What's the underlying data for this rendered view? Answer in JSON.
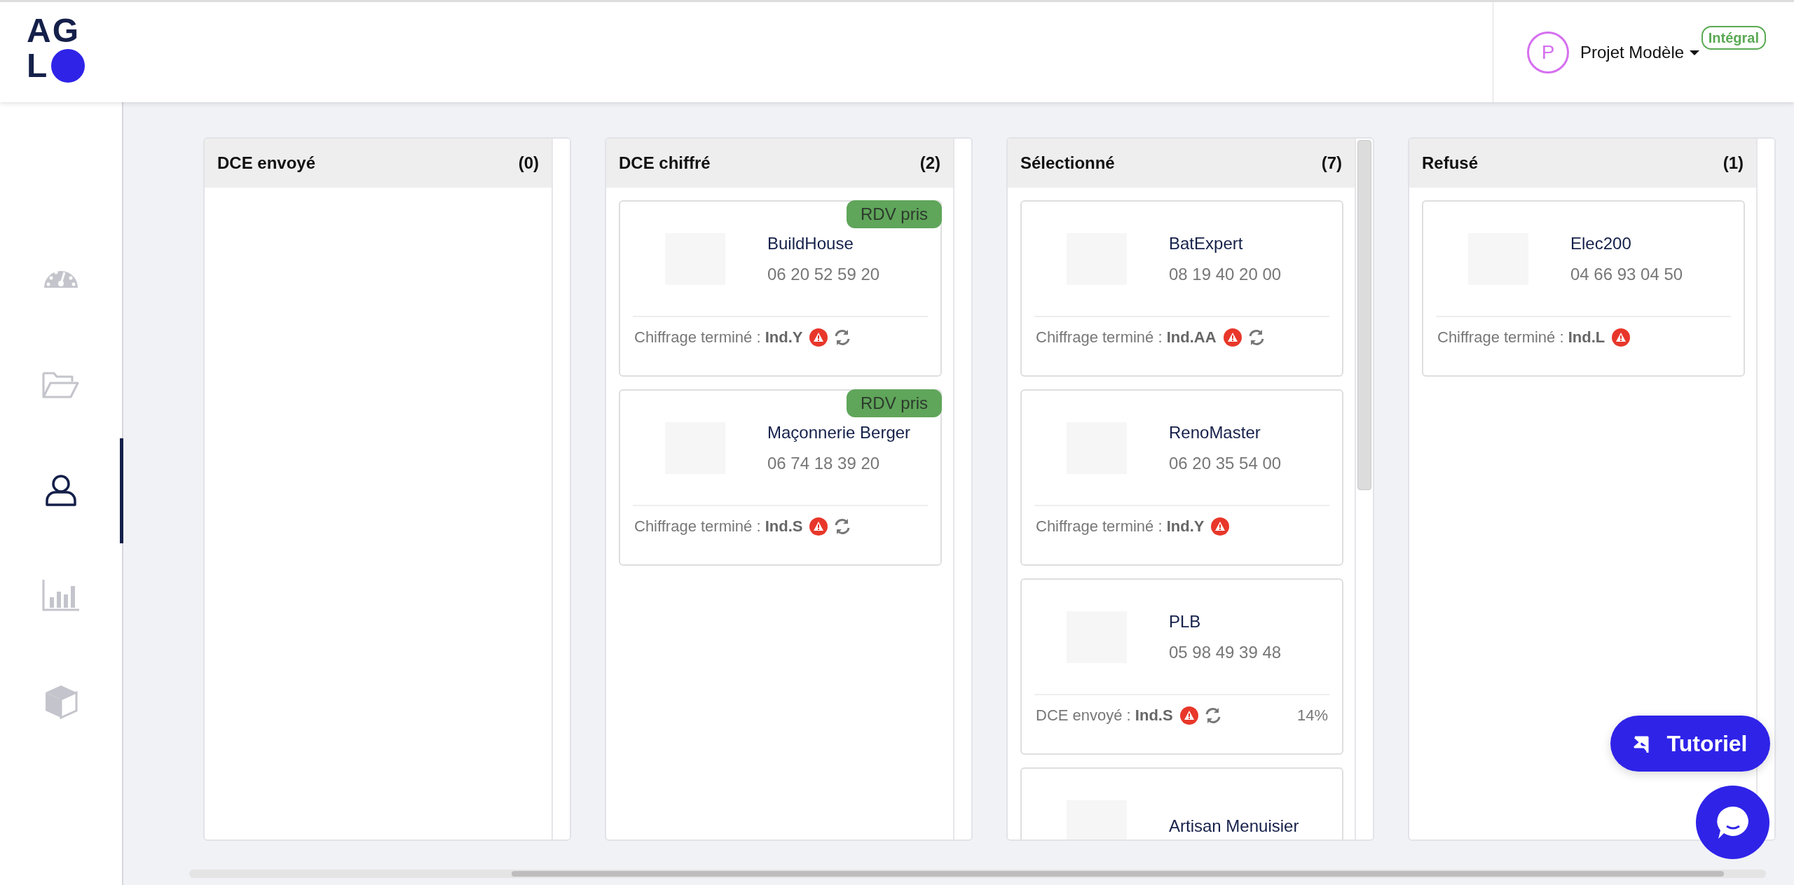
{
  "header": {
    "logo": {
      "line_1": "AG",
      "line_2": "L"
    },
    "user": {
      "avatar_letter": "P",
      "project": "Projet Modèle",
      "plan_badge": "Intégral"
    }
  },
  "sidebar": {
    "items": [
      {
        "kind": "gauge",
        "selected": false
      },
      {
        "kind": "folder",
        "selected": false
      },
      {
        "kind": "user",
        "selected": true
      },
      {
        "kind": "chart",
        "selected": false
      },
      {
        "kind": "cube",
        "selected": false
      }
    ]
  },
  "columns": [
    {
      "title": "DCE envoyé",
      "count": "(0)"
    },
    {
      "title": "DCE chiffré",
      "count": "(2)",
      "cards": [
        {
          "name": "BuildHouse",
          "phone": "06 20 52 59 20",
          "badge": "RDV pris",
          "status": "Chiffrage terminé : **Ind.Y**",
          "warning": true,
          "refresh": true
        },
        {
          "name": "Maçonnerie Berger",
          "phone": "06 74 18 39 20",
          "badge": "RDV pris",
          "status": "Chiffrage terminé : **Ind.S**",
          "warning": true,
          "refresh": true
        }
      ]
    },
    {
      "title": "Sélectionné",
      "count": "(7)",
      "scrollbar": true,
      "cards": [
        {
          "name": "BatExpert",
          "phone": "08 19 40 20 00",
          "status": "Chiffrage terminé : **Ind.AA**",
          "warning": true,
          "refresh": true
        },
        {
          "name": "RenoMaster",
          "phone": "06 20 35 54 00",
          "status": "Chiffrage terminé : **Ind.Y**",
          "warning": true,
          "refresh": false
        },
        {
          "name": "PLB",
          "phone": "05 98 49 39 48",
          "status": "DCE envoyé : **Ind.S**",
          "warning": true,
          "refresh": true,
          "percent": "14%"
        },
        {
          "name": "Artisan Menuisier"
        }
      ]
    },
    {
      "title": "Refusé",
      "count": "(1)",
      "cards": [
        {
          "name": "Elec200",
          "phone": "04 66 93 04 50",
          "status": "Chiffrage terminé : **Ind.L**",
          "warning": true,
          "refresh": false
        }
      ]
    }
  ],
  "tutorial_button": {
    "label": "Tutoriel"
  }
}
